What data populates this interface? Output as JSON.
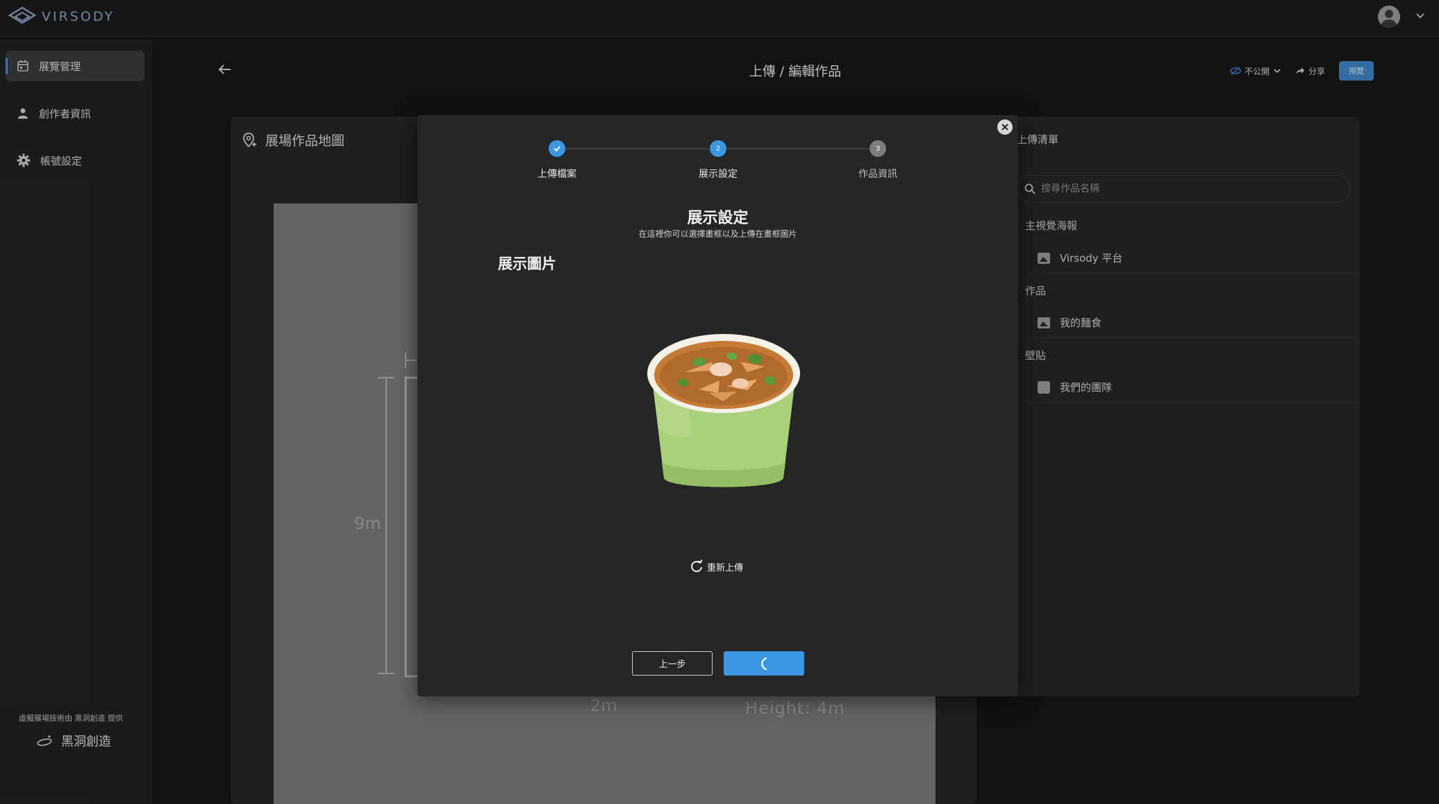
{
  "app": {
    "logo_text": "VIRSODY"
  },
  "sidebar": {
    "items": [
      {
        "label": "展覽管理",
        "icon": "calendar-icon",
        "active": true
      },
      {
        "label": "創作者資訊",
        "icon": "person-icon",
        "active": false
      },
      {
        "label": "帳號設定",
        "icon": "gear-icon",
        "active": false
      }
    ],
    "footer_text": "虛擬展場技術由 黑洞創造 提供",
    "footer_brand": "黑洞創造"
  },
  "header": {
    "title": "上傳 / 編輯作品",
    "visibility_label": "不公開",
    "share_label": "分享",
    "preview_label": "預覽"
  },
  "map": {
    "title": "展場作品地圖",
    "dim_height_label": "9m",
    "dim_width_label": "2m",
    "height_text": "Height: 4m"
  },
  "upload_list": {
    "title": "上傳清單",
    "search_placeholder": "搜尋作品名稱",
    "groups": [
      {
        "label": "主視覺海報",
        "items": [
          "Virsody 平台"
        ]
      },
      {
        "label": "作品",
        "items": [
          "我的麵食"
        ]
      },
      {
        "label": "壁貼",
        "items": [
          "我們的團隊"
        ]
      }
    ]
  },
  "modal": {
    "steps": [
      {
        "label": "上傳檔案",
        "number": "1",
        "state": "done"
      },
      {
        "label": "展示設定",
        "number": "2",
        "state": "current"
      },
      {
        "label": "作品資訊",
        "number": "3",
        "state": "pending"
      }
    ],
    "heading": "展示設定",
    "subheading": "在這裡你可以選擇畫框以及上傳在畫框圖片",
    "section_title": "展示圖片",
    "reupload_label": "重新上傳",
    "prev_label": "上一步",
    "next_loading": true
  },
  "colors": {
    "accent": "#3c97e2",
    "background": "#171717",
    "panel": "#262626"
  }
}
